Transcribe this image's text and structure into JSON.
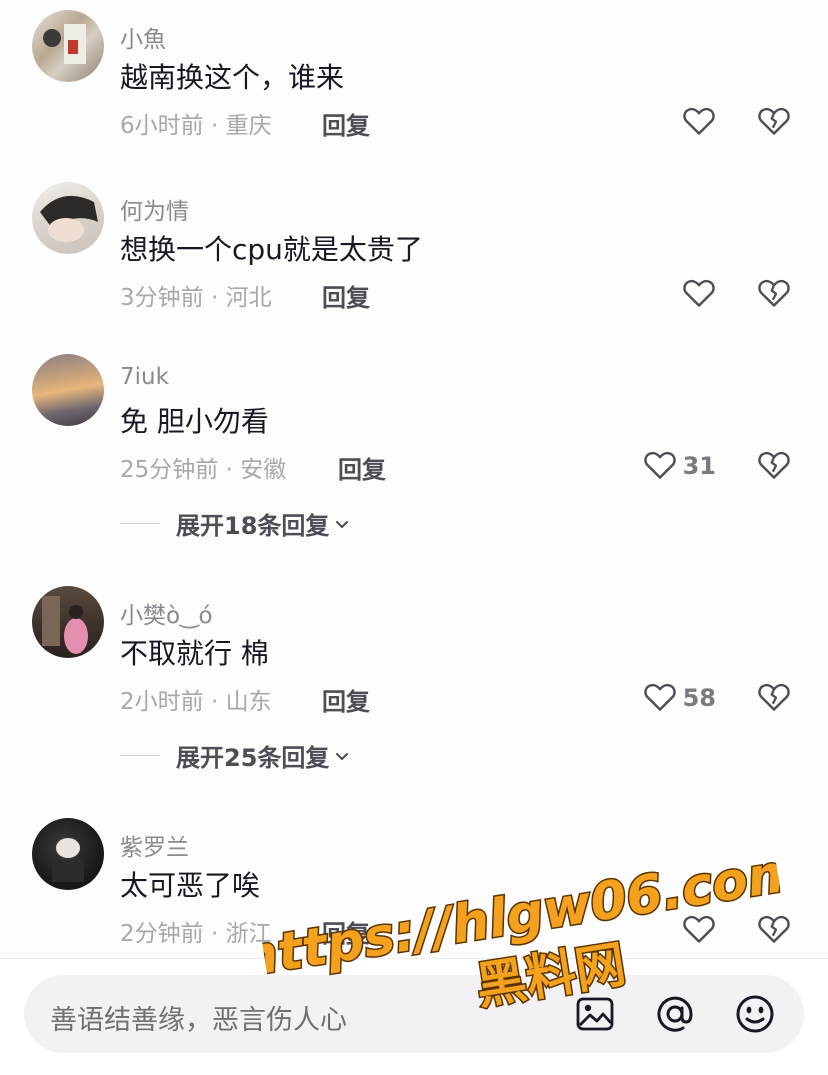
{
  "comments": [
    {
      "username": "小魚",
      "content": "越南换这个，谁来",
      "meta": "6小时前 · 重庆",
      "reply_label": "回复",
      "likes": "",
      "expand_label": ""
    },
    {
      "username": "何为情",
      "content": "想换一个cpu就是太贵了",
      "meta": "3分钟前 · 河北",
      "reply_label": "回复",
      "likes": "",
      "expand_label": ""
    },
    {
      "username": "7iuk",
      "content": "免 胆小勿看",
      "meta": "25分钟前 · 安徽",
      "reply_label": "回复",
      "likes": "31",
      "expand_label": "展开18条回复"
    },
    {
      "username": "小樊ὸ‿ό",
      "content": "不取就行 棉",
      "meta": "2小时前 · 山东",
      "reply_label": "回复",
      "likes": "58",
      "expand_label": "展开25条回复"
    },
    {
      "username": "紫罗兰",
      "content": "太可恶了唉",
      "meta": "2分钟前 · 浙江",
      "reply_label": "回复",
      "likes": "",
      "expand_label": ""
    }
  ],
  "input_bar": {
    "placeholder": "善语结善缘，恶言伤人心",
    "icons": [
      "image-icon",
      "at-icon",
      "emoji-icon"
    ]
  },
  "watermark": {
    "line1": "https://hlgw06.com",
    "line2": "黑料网",
    "color": "#f4a21d"
  },
  "colors": {
    "username": "#8a8b91",
    "meta": "#a7a8ad",
    "content": "#161823",
    "icon": "#4c4d55"
  }
}
